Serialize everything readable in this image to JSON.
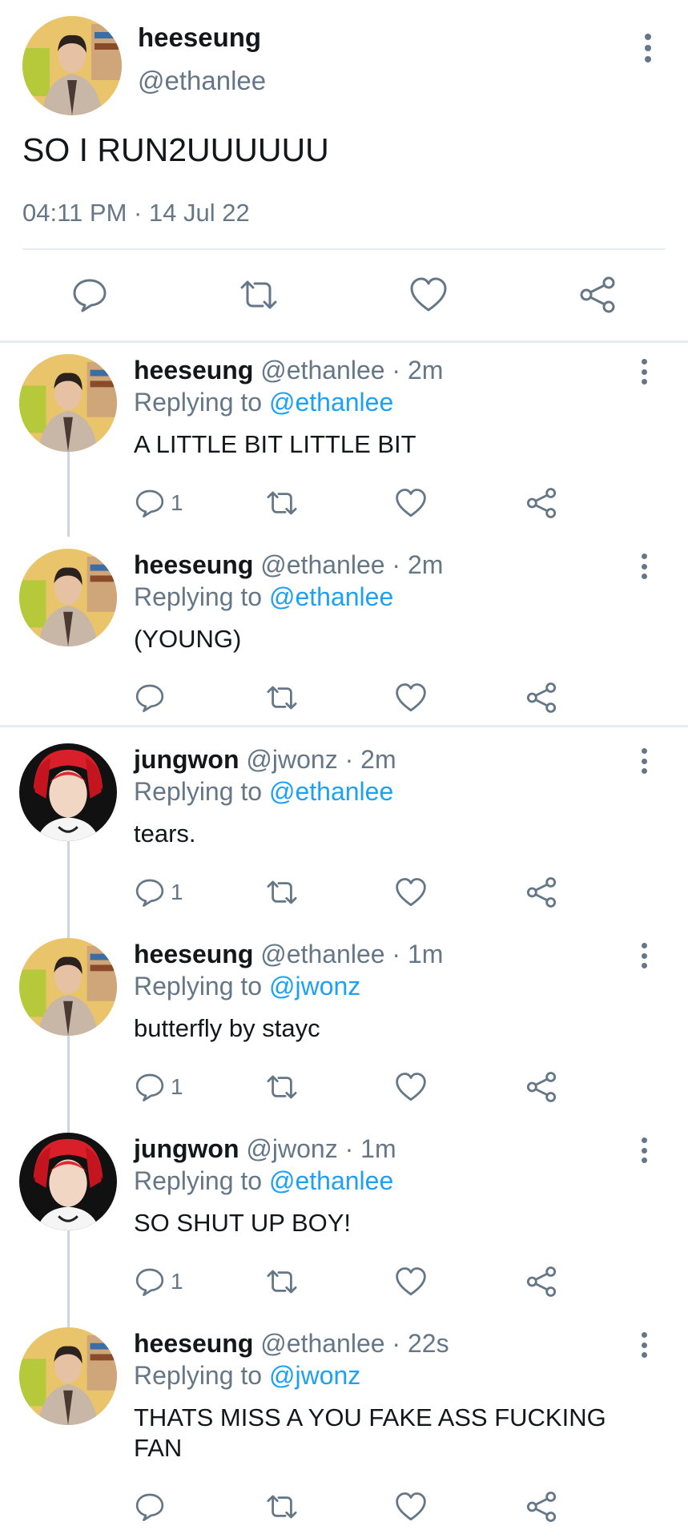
{
  "main_tweet": {
    "name": "heeseung",
    "handle": "@ethanlee",
    "text": "SO I RUN2UUUUUU",
    "timestamp": "04:11 PM · 14 Jul 22"
  },
  "replies": [
    {
      "name": "heeseung",
      "meta": "@ethanlee · 2m",
      "replying_prefix": "Replying to",
      "replying_to": "@ethanlee",
      "text": "A LITTLE BIT LITTLE BIT",
      "reply_count": "1",
      "avatar": "heeseung"
    },
    {
      "name": "heeseung",
      "meta": "@ethanlee · 2m",
      "replying_prefix": "Replying to",
      "replying_to": "@ethanlee",
      "text": "(YOUNG)",
      "reply_count": "",
      "avatar": "heeseung"
    },
    {
      "name": "jungwon",
      "meta": "@jwonz · 2m",
      "replying_prefix": "Replying to",
      "replying_to": "@ethanlee",
      "text": "tears.",
      "reply_count": "1",
      "avatar": "jungwon"
    },
    {
      "name": "heeseung",
      "meta": "@ethanlee · 1m",
      "replying_prefix": "Replying to",
      "replying_to": "@jwonz",
      "text": "butterfly by stayc",
      "reply_count": "1",
      "avatar": "heeseung"
    },
    {
      "name": "jungwon",
      "meta": "@jwonz · 1m",
      "replying_prefix": "Replying to",
      "replying_to": "@ethanlee",
      "text": "SO SHUT UP BOY!",
      "reply_count": "1",
      "avatar": "jungwon"
    },
    {
      "name": "heeseung",
      "meta": "@ethanlee · 22s",
      "replying_prefix": "Replying to",
      "replying_to": "@jwonz",
      "text": "THATS MISS A YOU FAKE ASS FUCKING FAN",
      "reply_count": "",
      "avatar": "heeseung"
    }
  ],
  "icons": {
    "reply": "comment-bubble-icon",
    "retweet": "retweet-icon",
    "like": "heart-icon",
    "share": "share-icon",
    "more": "vertical-dots-icon"
  },
  "colors": {
    "text": "#14171a",
    "muted": "#657786",
    "link": "#1da1f2",
    "divider": "#e6ecf0"
  }
}
